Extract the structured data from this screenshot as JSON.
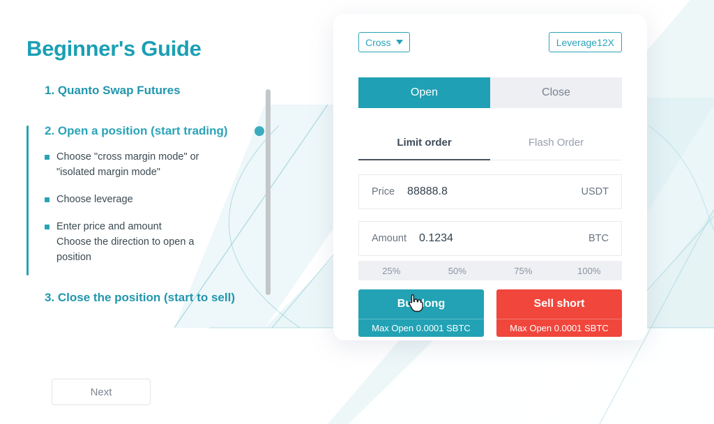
{
  "guide": {
    "title": "Beginner's Guide",
    "sections": [
      {
        "heading": "1. Quanto Swap Futures",
        "active": false,
        "bullets": []
      },
      {
        "heading": "2. Open a position (start trading)",
        "active": true,
        "bullets": [
          {
            "line1": "Choose \"cross margin mode\" or",
            "line2": "\"isolated margin mode\""
          },
          {
            "line1": "Choose leverage",
            "line2": ""
          },
          {
            "line1": "Enter price and amount",
            "line2": "Choose the direction to open a",
            "line3": "position"
          }
        ]
      },
      {
        "heading": "3. Close the position (start to sell)",
        "active": false,
        "bullets": []
      }
    ],
    "next_label": "Next",
    "scrollbar": "vertical-scrollbar"
  },
  "card": {
    "margin_mode": {
      "label": "Cross",
      "icon": "chevron-down-icon"
    },
    "leverage": {
      "label": "Leverage12X"
    },
    "position_tabs": [
      {
        "label": "Open",
        "active": true
      },
      {
        "label": "Close",
        "active": false
      }
    ],
    "order_tabs": [
      {
        "label": "Limit order",
        "active": true
      },
      {
        "label": "Flash Order",
        "active": false
      }
    ],
    "price_field": {
      "label": "Price",
      "value": "88888.8",
      "unit": "USDT",
      "placeholder": "Price"
    },
    "amount_field": {
      "label": "Amount",
      "value": "0.1234",
      "unit": "BTC",
      "placeholder": "Amount"
    },
    "percent_options": [
      "25%",
      "50%",
      "75%",
      "100%"
    ],
    "buy": {
      "label": "Buy long",
      "sub": "Max Open 0.0001 SBTC"
    },
    "sell": {
      "label": "Sell short",
      "sub": "Max Open 0.0001 SBTC"
    }
  },
  "cursor": {
    "icon": "pointing-hand-cursor"
  },
  "colors": {
    "teal": "#2aa3b8",
    "teal_solid": "#20a0b4",
    "red": "#f0463c",
    "text_dark": "#3b4a52",
    "text_muted": "#8b93a0",
    "bg_tint": "#dff0f2",
    "page_bg": "#ffffff"
  }
}
